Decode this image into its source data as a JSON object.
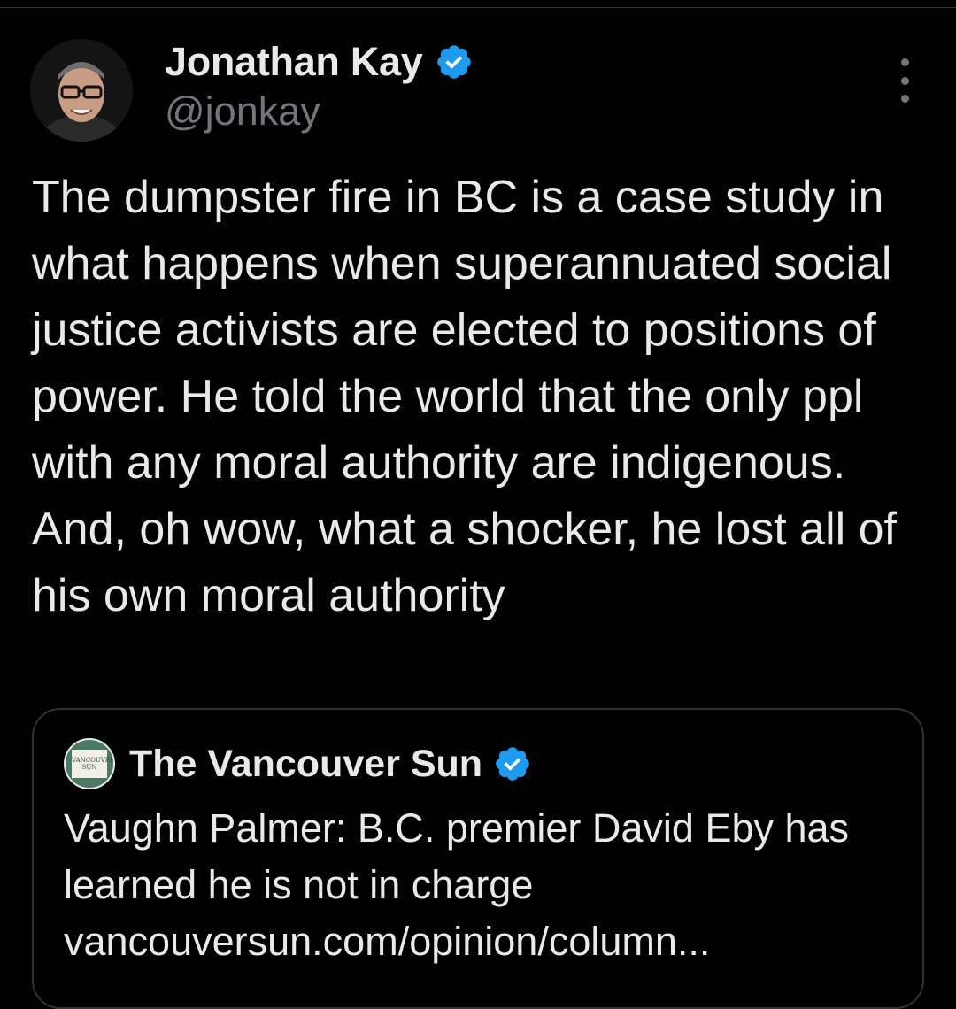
{
  "tweet": {
    "author": {
      "name": "Jonathan Kay",
      "handle": "@jonkay",
      "verified": true,
      "avatar_icon": "profile-photo"
    },
    "more_icon": "more-vertical-icon",
    "text": "The dumpster fire in BC is a case study in what happens when superannuated social justice activists are elected to positions of power. He told the world that the only ppl with any moral authority are indigenous. And, oh wow, what a shocker, he lost all of his own moral authority"
  },
  "quote_tweet": {
    "author": {
      "name": "The Vancouver Sun",
      "verified": true,
      "avatar_icon": "vancouver-sun-logo"
    },
    "text": "Vaughn Palmer: B.C. premier David Eby has learned he is not in charge vancouversun.com/opinion/column..."
  },
  "colors": {
    "background": "#000000",
    "text_primary": "#e7e9ea",
    "text_secondary": "#71767b",
    "verified_blue": "#1d9bf0",
    "border": "#2f3336"
  }
}
